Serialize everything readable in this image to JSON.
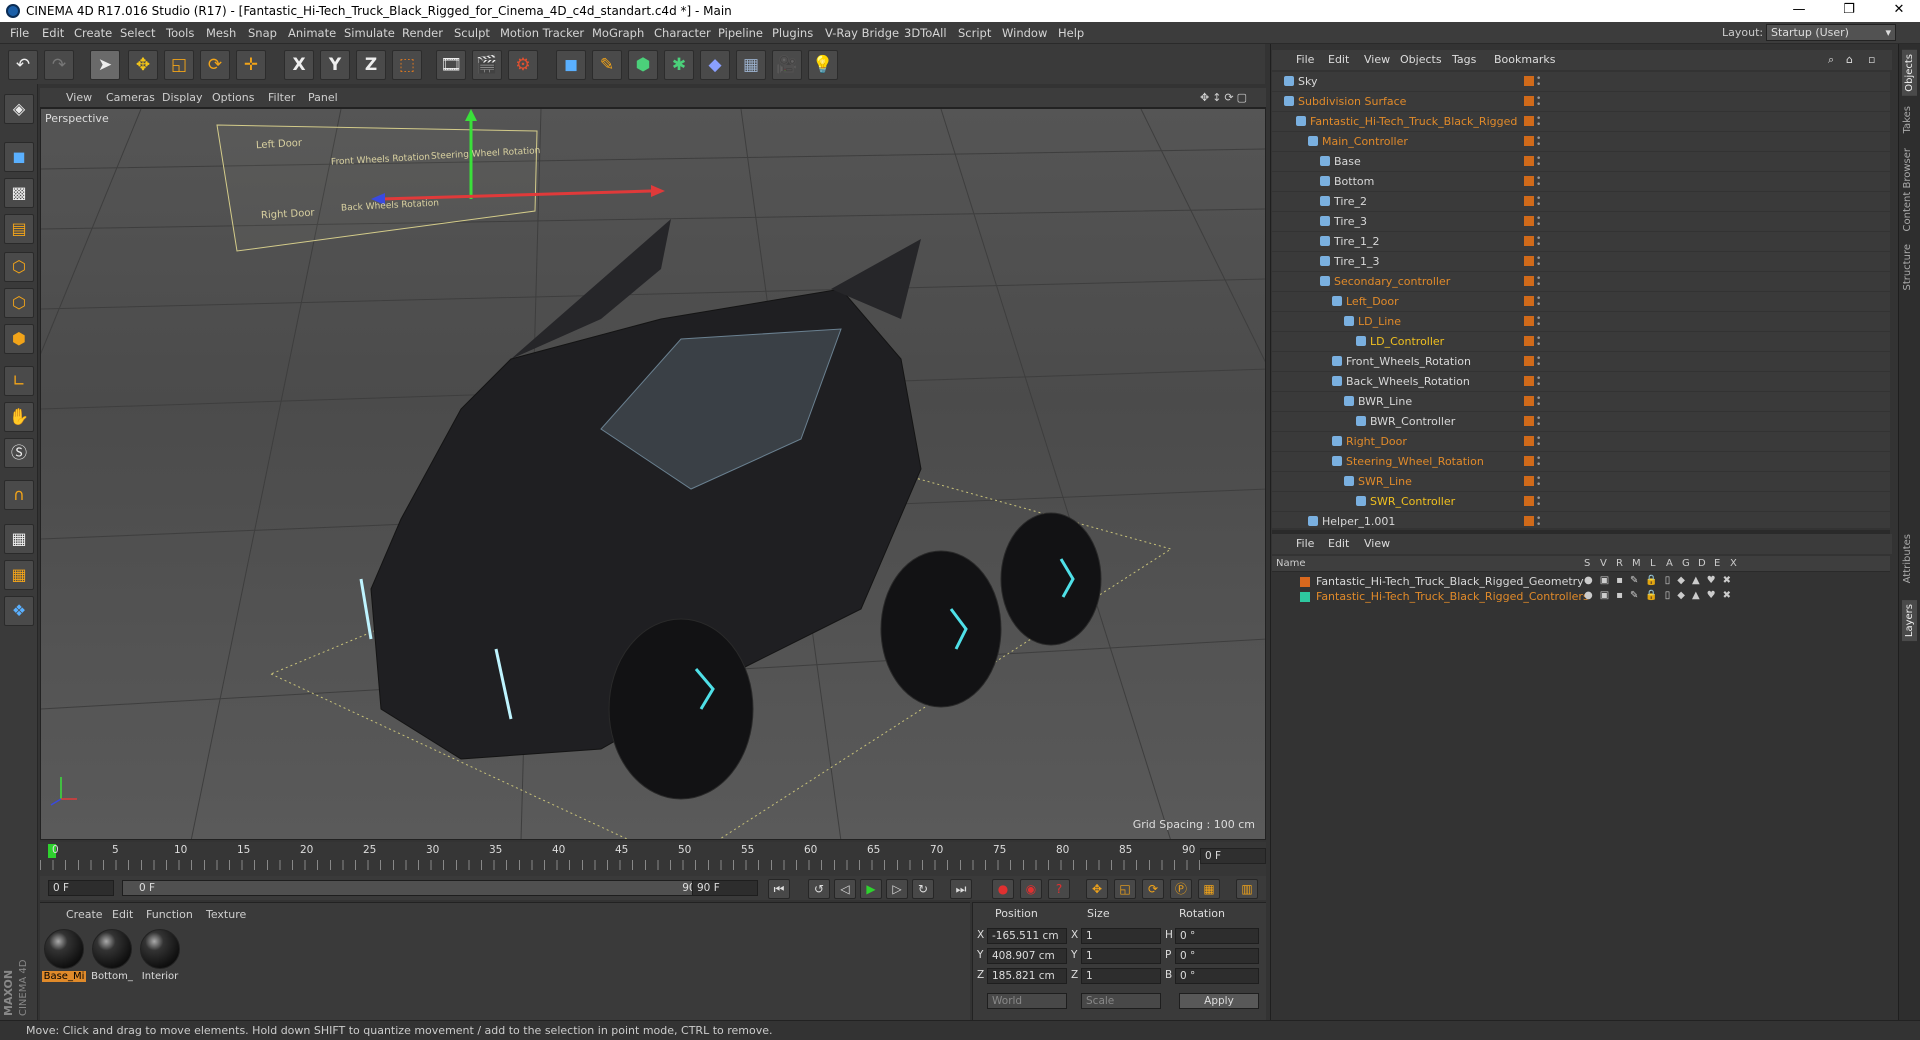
{
  "window": {
    "title": "CINEMA 4D R17.016 Studio (R17) - [Fantastic_Hi-Tech_Truck_Black_Rigged_for_Cinema_4D_c4d_standart.c4d *] - Main",
    "controls": [
      "—",
      "❐",
      "✕"
    ]
  },
  "menu": [
    "File",
    "Edit",
    "Create",
    "Select",
    "Tools",
    "Mesh",
    "Snap",
    "Animate",
    "Simulate",
    "Render",
    "Sculpt",
    "Motion Tracker",
    "MoGraph",
    "Character",
    "Pipeline",
    "Plugins",
    "V-Ray Bridge",
    "3DToAll",
    "Script",
    "Window",
    "Help"
  ],
  "layout": {
    "label": "Layout:",
    "value": "Startup (User)"
  },
  "toolbar": {
    "axis_x": "X",
    "axis_y": "Y",
    "axis_z": "Z"
  },
  "viewport": {
    "menu": [
      "View",
      "Cameras",
      "Display",
      "Options",
      "Filter",
      "Panel"
    ],
    "camera": "Perspective",
    "grid_spacing": "Grid Spacing : 100 cm",
    "rig_labels": {
      "left_door": "Left Door",
      "right_door": "Right Door",
      "front_wheels": "Front Wheels Rotation",
      "steering": "Steering Wheel Rotation",
      "back_wheels": "Back Wheels Rotation"
    }
  },
  "timeline": {
    "ticks": [
      "0",
      "5",
      "10",
      "15",
      "20",
      "25",
      "30",
      "35",
      "40",
      "45",
      "50",
      "55",
      "60",
      "65",
      "70",
      "75",
      "80",
      "85",
      "90"
    ],
    "current_frame": "0 F",
    "start_field": "0 F",
    "range_start": "0 F",
    "range_end": "90 F",
    "end_field": "90 F"
  },
  "materials": {
    "menu": [
      "Create",
      "Edit",
      "Function",
      "Texture"
    ],
    "items": [
      {
        "label": "Base_Mi"
      },
      {
        "label": "Bottom_"
      },
      {
        "label": "Interior"
      }
    ]
  },
  "attributes": {
    "headers": {
      "position": "Position",
      "size": "Size",
      "rotation": "Rotation"
    },
    "rows": [
      {
        "axis": "X",
        "pos": "-165.511 cm",
        "size_axis": "X",
        "size": "1",
        "rot_axis": "H",
        "rot": "0 °"
      },
      {
        "axis": "Y",
        "pos": "408.907 cm",
        "size_axis": "Y",
        "size": "1",
        "rot_axis": "P",
        "rot": "0 °"
      },
      {
        "axis": "Z",
        "pos": "185.821 cm",
        "size_axis": "Z",
        "size": "1",
        "rot_axis": "B",
        "rot": "0 °"
      }
    ],
    "coord_mode": "World",
    "size_mode": "Scale",
    "apply": "Apply"
  },
  "object_manager": {
    "menu": [
      "File",
      "Edit",
      "View",
      "Objects",
      "Tags",
      "Bookmarks"
    ],
    "objects": [
      {
        "name": "Sky",
        "color": "white",
        "depth": 0
      },
      {
        "name": "Subdivision Surface",
        "color": "orange",
        "depth": 0
      },
      {
        "name": "Fantastic_Hi-Tech_Truck_Black_Rigged",
        "color": "orange",
        "depth": 1
      },
      {
        "name": "Main_Controller",
        "color": "orange",
        "depth": 2
      },
      {
        "name": "Base",
        "color": "white",
        "depth": 3
      },
      {
        "name": "Bottom",
        "color": "white",
        "depth": 3
      },
      {
        "name": "Tire_2",
        "color": "white",
        "depth": 3
      },
      {
        "name": "Tire_3",
        "color": "white",
        "depth": 3
      },
      {
        "name": "Tire_1_2",
        "color": "white",
        "depth": 3
      },
      {
        "name": "Tire_1_3",
        "color": "white",
        "depth": 3
      },
      {
        "name": "Secondary_controller",
        "color": "orange",
        "depth": 3
      },
      {
        "name": "Left_Door",
        "color": "orange",
        "depth": 4
      },
      {
        "name": "LD_Line",
        "color": "orange",
        "depth": 5
      },
      {
        "name": "LD_Controller",
        "color": "yellow",
        "depth": 6
      },
      {
        "name": "Front_Wheels_Rotation",
        "color": "white",
        "depth": 4
      },
      {
        "name": "Back_Wheels_Rotation",
        "color": "white",
        "depth": 4
      },
      {
        "name": "BWR_Line",
        "color": "white",
        "depth": 5
      },
      {
        "name": "BWR_Controller",
        "color": "white",
        "depth": 6
      },
      {
        "name": "Right_Door",
        "color": "orange",
        "depth": 4
      },
      {
        "name": "Steering_Wheel_Rotation",
        "color": "orange",
        "depth": 4
      },
      {
        "name": "SWR_Line",
        "color": "orange",
        "depth": 5
      },
      {
        "name": "SWR_Controller",
        "color": "yellow",
        "depth": 6
      },
      {
        "name": "Helper_1.001",
        "color": "white",
        "depth": 2
      }
    ]
  },
  "layer_manager": {
    "menu": [
      "File",
      "Edit",
      "View"
    ],
    "columns": [
      "Name",
      "S",
      "V",
      "R",
      "M",
      "L",
      "A",
      "G",
      "D",
      "E",
      "X"
    ],
    "layers": [
      {
        "name": "Fantastic_Hi-Tech_Truck_Black_Rigged_Geometry",
        "swatch": "#d9681e",
        "color": "white"
      },
      {
        "name": "Fantastic_Hi-Tech_Truck_Black_Rigged_Controllers",
        "swatch": "#2ec8a0",
        "color": "orange"
      }
    ]
  },
  "side_tabs": [
    "Objects",
    "Takes",
    "Content Browser",
    "Structure",
    "Attributes",
    "Layers"
  ],
  "status": "Move: Click and drag to move elements. Hold down SHIFT to quantize movement / add to the selection in point mode, CTRL to remove.",
  "brand": {
    "line1": "MAXON",
    "line2": "CINEMA 4D"
  }
}
